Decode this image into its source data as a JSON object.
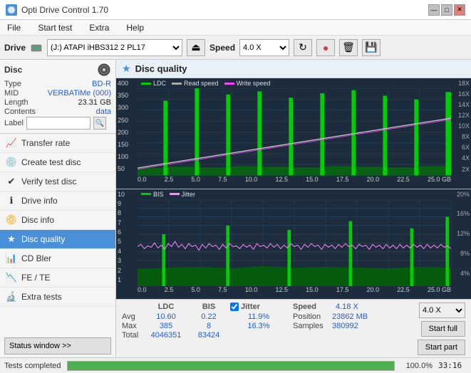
{
  "app": {
    "title": "Opti Drive Control 1.70",
    "title_icon": "●"
  },
  "titlebar": {
    "minimize": "—",
    "maximize": "□",
    "close": "✕"
  },
  "menu": {
    "items": [
      "File",
      "Start test",
      "Extra",
      "Help"
    ]
  },
  "drive_bar": {
    "label": "Drive",
    "drive_value": "(J:)  ATAPI iHBS312  2 PL17",
    "speed_label": "Speed",
    "speed_value": "4.0 X",
    "eject_icon": "⏏"
  },
  "disc": {
    "header": "Disc",
    "type_label": "Type",
    "type_value": "BD-R",
    "mid_label": "MID",
    "mid_value": "VERBATiMe (000)",
    "length_label": "Length",
    "length_value": "23.31 GB",
    "contents_label": "Contents",
    "contents_value": "data",
    "label_label": "Label",
    "label_placeholder": ""
  },
  "nav": {
    "items": [
      {
        "id": "transfer-rate",
        "label": "Transfer rate",
        "icon": "📈"
      },
      {
        "id": "create-test-disc",
        "label": "Create test disc",
        "icon": "💿"
      },
      {
        "id": "verify-test-disc",
        "label": "Verify test disc",
        "icon": "✔"
      },
      {
        "id": "drive-info",
        "label": "Drive info",
        "icon": "ℹ"
      },
      {
        "id": "disc-info",
        "label": "Disc info",
        "icon": "📀"
      },
      {
        "id": "disc-quality",
        "label": "Disc quality",
        "icon": "★",
        "active": true
      },
      {
        "id": "cd-bler",
        "label": "CD Bler",
        "icon": "📊"
      },
      {
        "id": "fe-te",
        "label": "FE / TE",
        "icon": "📉"
      },
      {
        "id": "extra-tests",
        "label": "Extra tests",
        "icon": "🔬"
      }
    ],
    "status_btn": "Status window >>"
  },
  "content": {
    "title": "Disc quality",
    "icon": "★"
  },
  "chart1": {
    "title": "LDC",
    "legend": [
      {
        "label": "LDC",
        "color": "#00aa00"
      },
      {
        "label": "Read speed",
        "color": "#888888"
      },
      {
        "label": "Write speed",
        "color": "#ff00ff"
      }
    ],
    "y_left": [
      "400",
      "350",
      "300",
      "250",
      "200",
      "150",
      "100",
      "50"
    ],
    "y_right": [
      "18X",
      "16X",
      "14X",
      "12X",
      "10X",
      "8X",
      "6X",
      "4X",
      "2X"
    ],
    "x_axis": [
      "0.0",
      "2.5",
      "5.0",
      "7.5",
      "10.0",
      "12.5",
      "15.0",
      "17.5",
      "20.0",
      "22.5",
      "25.0 GB"
    ]
  },
  "chart2": {
    "title": "BIS",
    "legend": [
      {
        "label": "BIS",
        "color": "#00aa00"
      },
      {
        "label": "Jitter",
        "color": "#ff88ff"
      }
    ],
    "y_left": [
      "10",
      "9",
      "8",
      "7",
      "6",
      "5",
      "4",
      "3",
      "2",
      "1"
    ],
    "y_right": [
      "20%",
      "16%",
      "12%",
      "8%",
      "4%"
    ],
    "x_axis": [
      "0.0",
      "2.5",
      "5.0",
      "7.5",
      "10.0",
      "12.5",
      "15.0",
      "17.5",
      "20.0",
      "22.5",
      "25.0 GB"
    ]
  },
  "stats": {
    "ldc_label": "LDC",
    "bis_label": "BIS",
    "jitter_label": "Jitter",
    "speed_label": "Speed",
    "avg_label": "Avg",
    "max_label": "Max",
    "total_label": "Total",
    "ldc_avg": "10.60",
    "ldc_max": "385",
    "ldc_total": "4046351",
    "bis_avg": "0.22",
    "bis_max": "8",
    "bis_total": "83424",
    "jitter_avg": "11.9%",
    "jitter_max": "16.3%",
    "speed_val": "4.18 X",
    "position_label": "Position",
    "position_val": "23862 MB",
    "samples_label": "Samples",
    "samples_val": "380992",
    "speed_select": "4.0 X",
    "start_full": "Start full",
    "start_part": "Start part",
    "jitter_checked": true
  },
  "statusbar": {
    "text": "Tests completed",
    "progress": 100,
    "percent": "100.0%",
    "time": "33:16"
  }
}
